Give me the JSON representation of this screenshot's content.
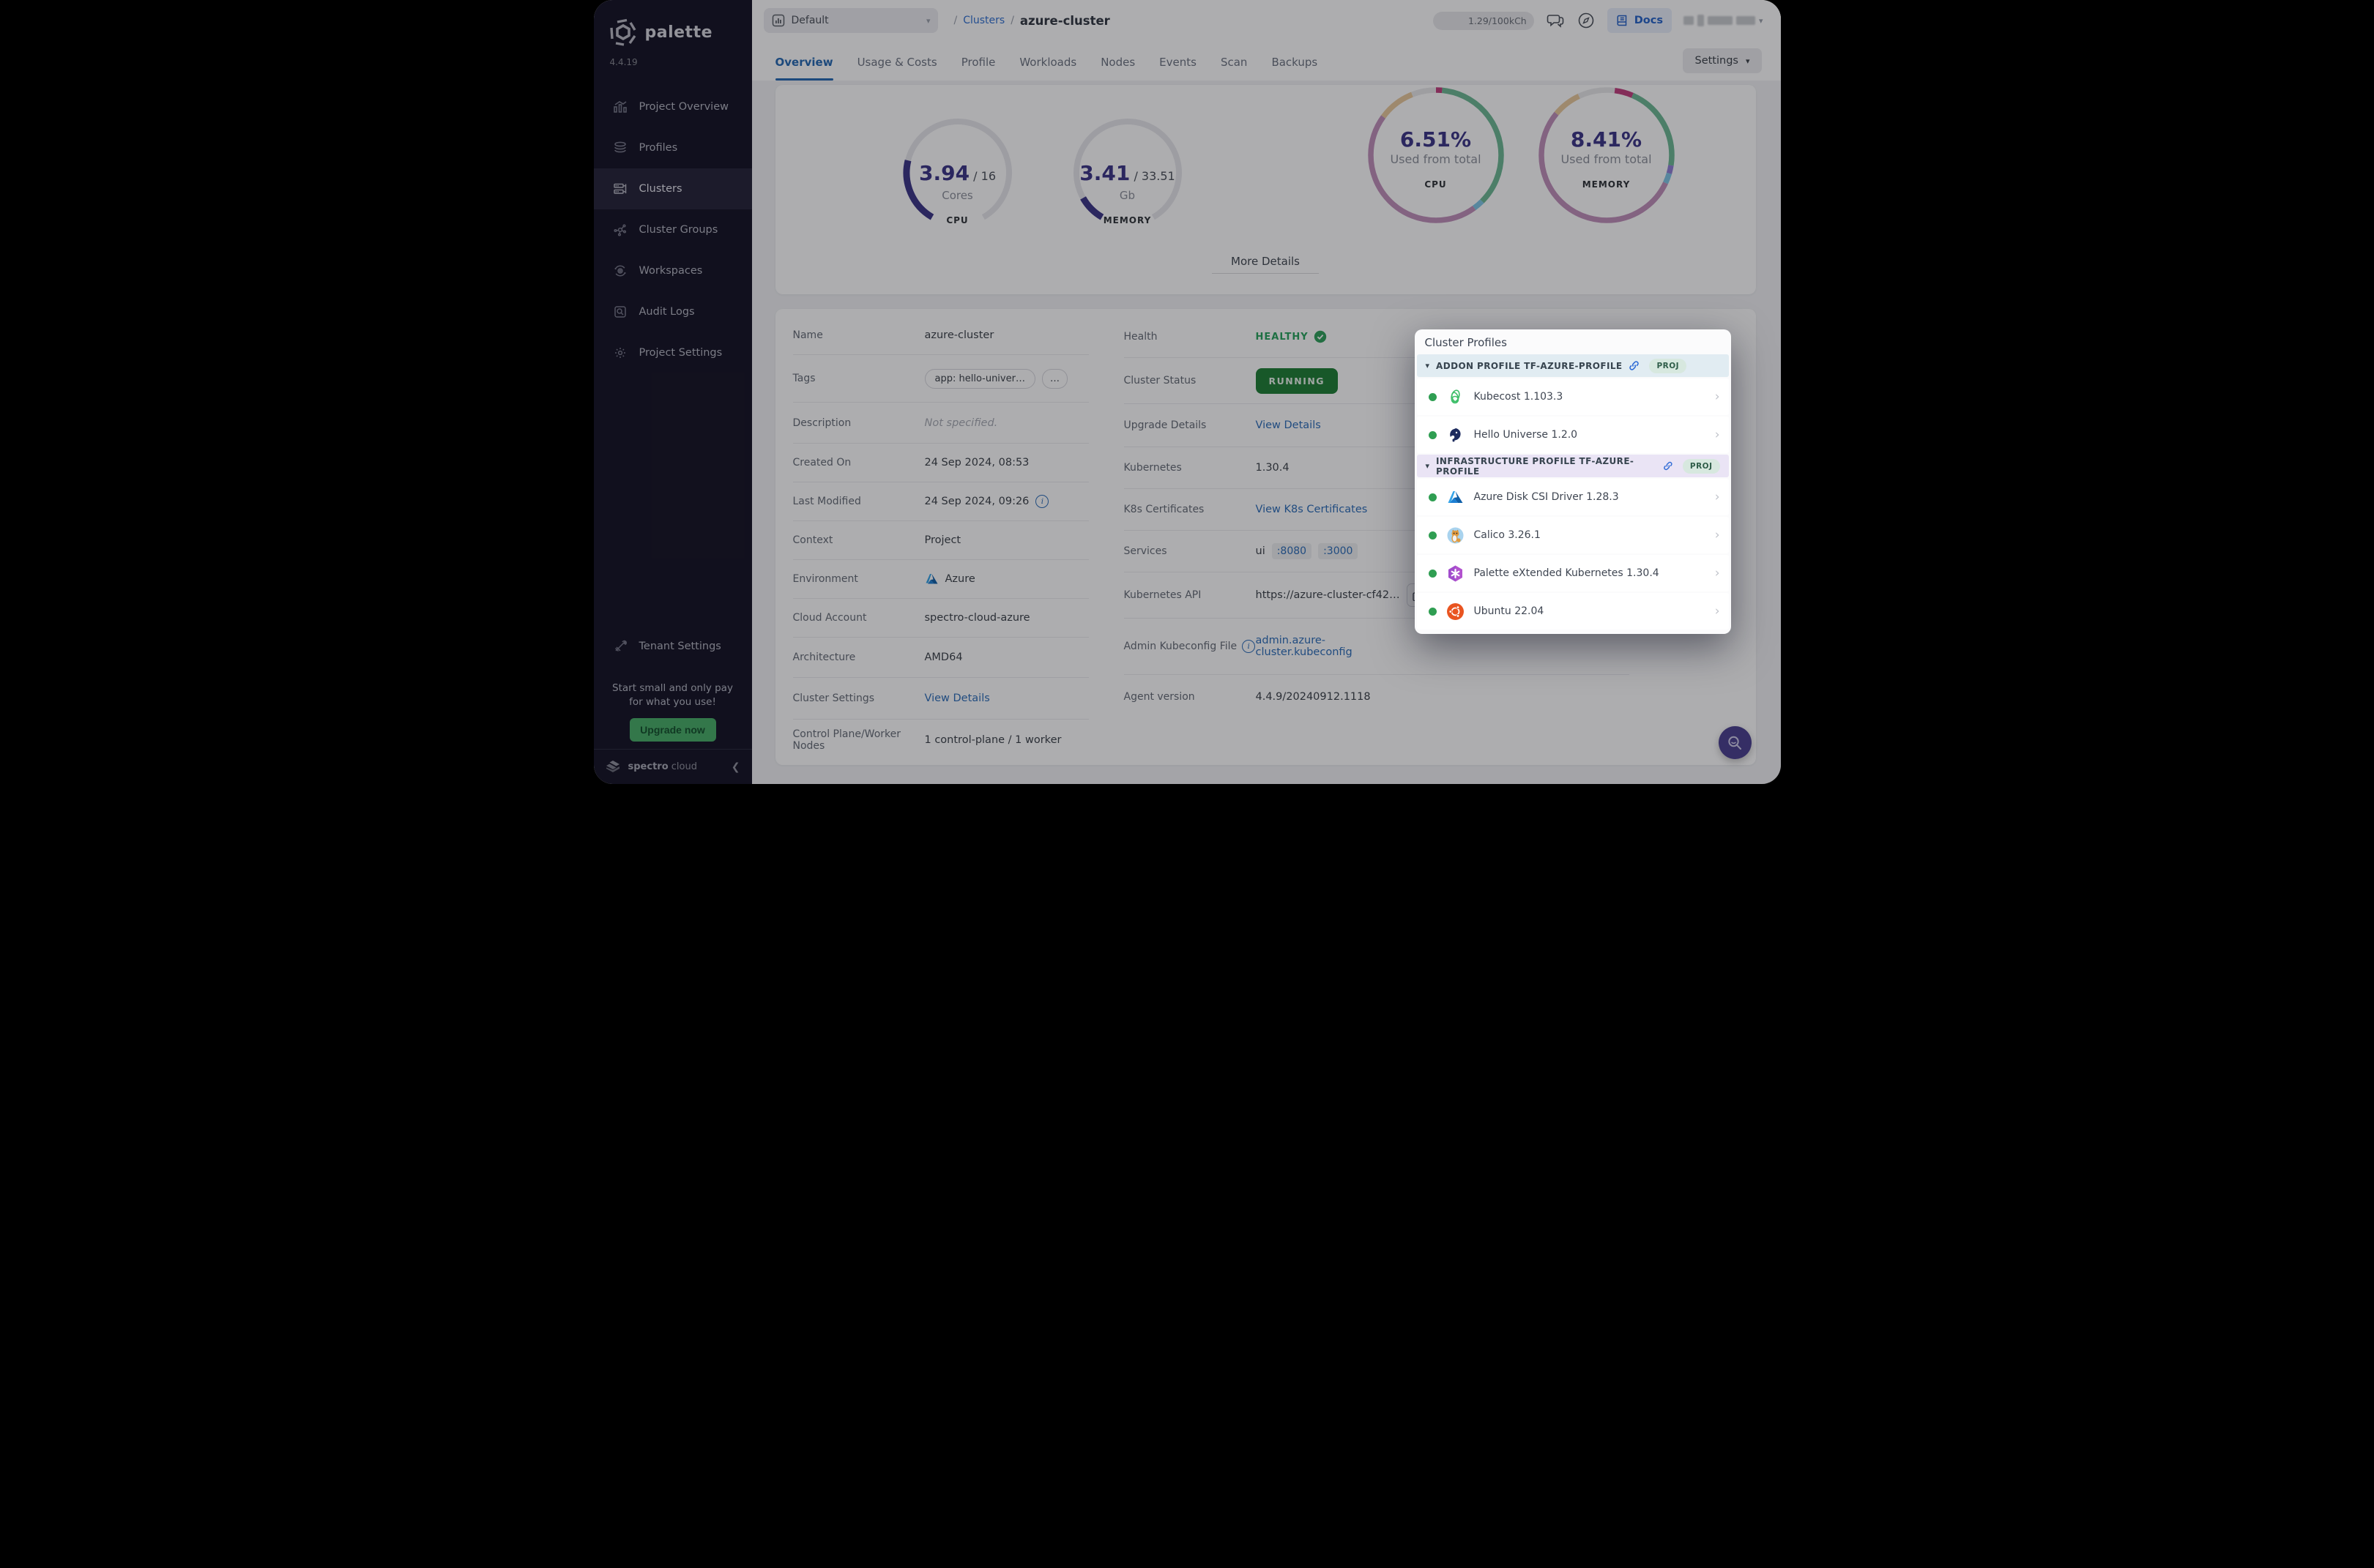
{
  "sidebar": {
    "brand": "palette",
    "version": "4.4.19",
    "items": [
      {
        "label": "Project Overview"
      },
      {
        "label": "Profiles"
      },
      {
        "label": "Clusters"
      },
      {
        "label": "Cluster Groups"
      },
      {
        "label": "Workspaces"
      },
      {
        "label": "Audit Logs"
      },
      {
        "label": "Project Settings"
      }
    ],
    "tenant_settings": "Tenant Settings",
    "promo_text": "Start small and only pay for what you use!",
    "upgrade_label": "Upgrade now",
    "footer_brand_strong": "spectro",
    "footer_brand_light": "cloud"
  },
  "topbar": {
    "project_selector": "Default",
    "breadcrumb_sep": "/",
    "breadcrumb_link": "Clusters",
    "breadcrumb_current": "azure-cluster",
    "usage": "1.29/100kCh",
    "docs_label": "Docs"
  },
  "tabs": {
    "items": [
      {
        "label": "Overview",
        "active": true
      },
      {
        "label": "Usage & Costs",
        "active": false
      },
      {
        "label": "Profile",
        "active": false
      },
      {
        "label": "Workloads",
        "active": false
      },
      {
        "label": "Nodes",
        "active": false
      },
      {
        "label": "Events",
        "active": false
      },
      {
        "label": "Scan",
        "active": false
      },
      {
        "label": "Backups",
        "active": false
      }
    ],
    "settings_label": "Settings"
  },
  "metrics": {
    "more_details": "More Details",
    "gauges": [
      {
        "value": 3.94,
        "max": 16,
        "value_display": "3.94",
        "max_display": "/ 16",
        "unit": "Cores",
        "label": "CPU",
        "color": "#3b3486",
        "track": "#e7e7ec"
      },
      {
        "value": 3.41,
        "max": 33.51,
        "value_display": "3.41",
        "max_display": "/ 33.51",
        "unit": "Gb",
        "label": "MEMORY",
        "color": "#3b3486",
        "track": "#e7e7ec"
      }
    ],
    "donuts": [
      {
        "pct_display": "6.51%",
        "caption": "Used from total",
        "label": "CPU",
        "segments": [
          {
            "color": "#c13d7d",
            "pct": 1.5
          },
          {
            "color": "#6cb893",
            "pct": 36
          },
          {
            "color": "#7fc6e6",
            "pct": 2.5
          },
          {
            "color": "#c08fba",
            "pct": 45
          },
          {
            "color": "#e9c89b",
            "pct": 9
          },
          {
            "color": "#e8e8ea",
            "pct": 6
          }
        ]
      },
      {
        "pct_display": "8.41%",
        "caption": "Used from total",
        "label": "MEMORY",
        "segments": [
          {
            "color": "#e8e8ea",
            "pct": 2
          },
          {
            "color": "#c13d7d",
            "pct": 4.5
          },
          {
            "color": "#6cb893",
            "pct": 21
          },
          {
            "color": "#8f7fd6",
            "pct": 2
          },
          {
            "color": "#7fc6e6",
            "pct": 2.5
          },
          {
            "color": "#c08fba",
            "pct": 54
          },
          {
            "color": "#e9c89b",
            "pct": 7
          },
          {
            "color": "#e8e8ea",
            "pct": 7
          }
        ]
      }
    ]
  },
  "details": {
    "left": [
      {
        "label": "Name",
        "value": "azure-cluster"
      },
      {
        "label": "Tags",
        "tag1": "app: hello-univer…",
        "tag2": "…"
      },
      {
        "label": "Description",
        "value": "Not specified."
      },
      {
        "label": "Created On",
        "value": "24 Sep 2024, 08:53"
      },
      {
        "label": "Last Modified",
        "value": "24 Sep 2024, 09:26"
      },
      {
        "label": "Context",
        "value": "Project"
      },
      {
        "label": "Environment",
        "value": "Azure"
      },
      {
        "label": "Cloud Account",
        "value": "spectro-cloud-azure"
      },
      {
        "label": "Architecture",
        "value": "AMD64"
      },
      {
        "label": "Cluster Settings",
        "value": "View Details"
      },
      {
        "label": "Control Plane/Worker Nodes",
        "value": "1 control-plane / 1 worker"
      }
    ],
    "right": [
      {
        "label": "Health",
        "value": "HEALTHY"
      },
      {
        "label": "Cluster Status",
        "value": "RUNNING"
      },
      {
        "label": "Upgrade Details",
        "value": "View Details"
      },
      {
        "label": "Kubernetes",
        "value": "1.30.4"
      },
      {
        "label": "K8s Certificates",
        "value": "View K8s Certificates"
      },
      {
        "label": "Services",
        "value": "ui",
        "port1": ":8080",
        "port2": ":3000"
      },
      {
        "label": "Kubernetes API",
        "value": "https://azure-cluster-cf42…"
      },
      {
        "label": "Admin Kubeconfig File",
        "value": "admin.azure-cluster.kubeconfig"
      },
      {
        "label": "Agent version",
        "value": "4.4.9/20240912.1118"
      }
    ]
  },
  "profiles_panel": {
    "title": "Cluster Profiles",
    "sections": [
      {
        "header": "ADDON PROFILE TF-AZURE-PROFILE",
        "badge": "PROJ",
        "items": [
          {
            "name": "Kubecost 1.103.3"
          },
          {
            "name": "Hello Universe 1.2.0"
          }
        ]
      },
      {
        "header": "INFRASTRUCTURE PROFILE TF-AZURE-PROFILE",
        "badge": "PROJ",
        "items": [
          {
            "name": "Azure Disk CSI Driver 1.28.3"
          },
          {
            "name": "Calico 3.26.1"
          },
          {
            "name": "Palette eXtended Kubernetes 1.30.4"
          },
          {
            "name": "Ubuntu 22.04"
          }
        ]
      }
    ]
  }
}
